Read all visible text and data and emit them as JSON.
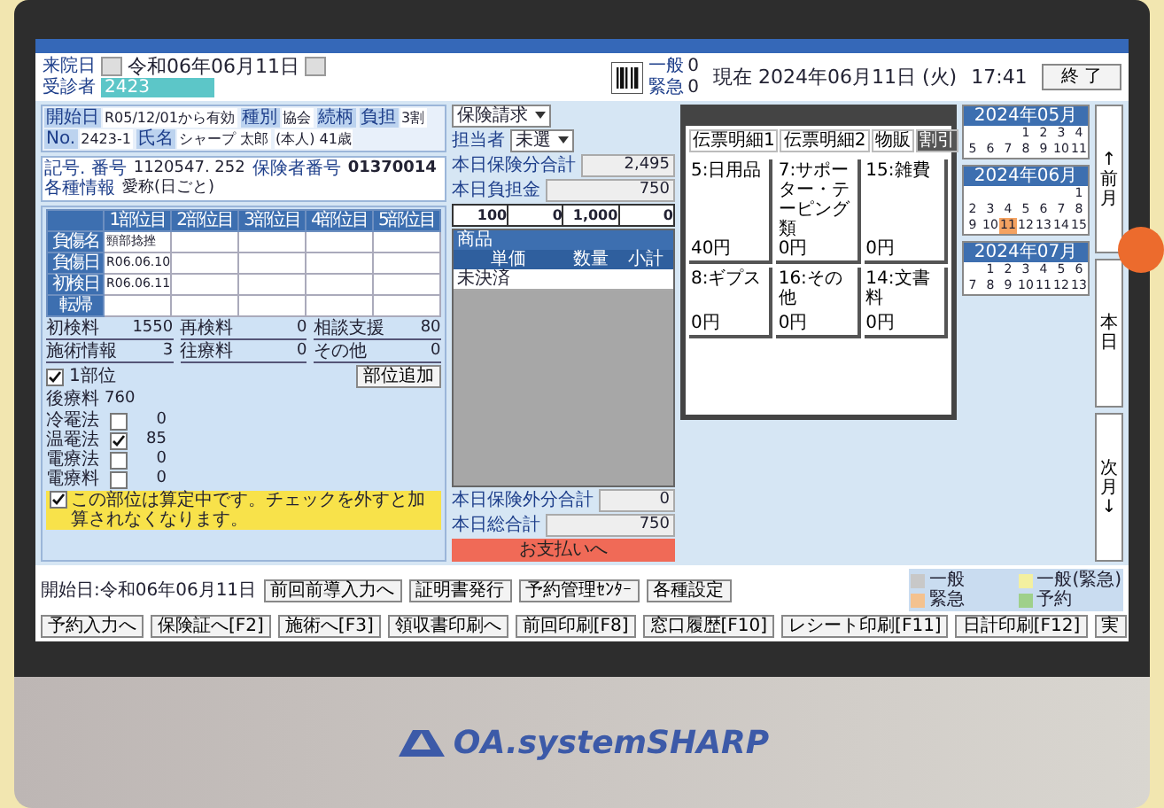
{
  "header": {
    "visit_label": "来院日",
    "visit_date": "令和06年06月11日",
    "patient_label": "受診者",
    "patient_no": "2423",
    "counters": [
      {
        "label": "一般",
        "value": "0"
      },
      {
        "label": "緊急",
        "value": "0"
      }
    ],
    "now": "現在 2024年06月11日 (火)",
    "time": "17:41",
    "end_button": "終 了"
  },
  "patient": {
    "rows": [
      [
        {
          "label": "開始日",
          "value": "R05/12/01から有効"
        },
        {
          "label": "種別",
          "value": "協会"
        },
        {
          "label": "続柄"
        },
        {
          "label": "負担",
          "value": "3割"
        }
      ],
      [
        {
          "label": "No.",
          "value": "2423-1"
        },
        {
          "label": "氏名",
          "value": "シャープ 太郎"
        },
        {
          "value": "(本人) 41歳"
        }
      ]
    ],
    "number_label": "記号. 番号",
    "number": "1120547. 252",
    "insurer_label": "保険者番号",
    "insurer": "01370014",
    "info_label": "各種情報",
    "info": "愛称(日ごと)"
  },
  "injury_table": {
    "columns": [
      "1部位目",
      "2部位目",
      "3部位目",
      "4部位目",
      "5部位目"
    ],
    "rows": [
      {
        "label": "負傷名",
        "cells": [
          "頸部捻挫"
        ]
      },
      {
        "label": "負傷日",
        "cells": [
          "R06.06.10"
        ]
      },
      {
        "label": "初検日",
        "cells": [
          "R06.06.11"
        ]
      },
      {
        "label": "転帰",
        "cells": []
      }
    ]
  },
  "fees": [
    {
      "label": "初検料",
      "value": "1550"
    },
    {
      "label": "再検料",
      "value": "0"
    },
    {
      "label": "相談支援",
      "value": "80"
    },
    {
      "label": "施術情報",
      "value": "3"
    },
    {
      "label": "往療料",
      "value": "0"
    },
    {
      "label": "その他",
      "value": "0"
    }
  ],
  "add_part_button": "部位追加",
  "one_part": {
    "label": "1部位",
    "checked": true
  },
  "aftercare": {
    "label": "後療料",
    "value": "760"
  },
  "options": [
    {
      "label": "冷罨法",
      "checked": false,
      "value": "0"
    },
    {
      "label": "温罨法",
      "checked": true,
      "value": "85"
    },
    {
      "label": "電療法",
      "checked": false,
      "value": "0"
    },
    {
      "label": "電療料",
      "checked": false,
      "value": "0"
    }
  ],
  "notice": {
    "checked": true,
    "text": "この部位は算定中です。チェックを外すと加算されなくなります。"
  },
  "billing": {
    "mode": "保険請求",
    "staff_label": "担当者",
    "staff": "未選",
    "insurance_total_label": "本日保険分合計",
    "insurance_total": "2,495",
    "copay_label": "本日負担金",
    "copay": "750",
    "summary_values": [
      "100",
      "0",
      "1,000",
      "0"
    ]
  },
  "goods": {
    "header": "商品",
    "columns": [
      "単価",
      "数量",
      "小計"
    ],
    "row_label": "未決済",
    "other_total_label": "本日保険外分合計",
    "other_total": "0",
    "grand_total_label": "本日総合計",
    "grand_total": "750",
    "pay_button": "お支払いへ"
  },
  "popup": {
    "tabs": [
      {
        "label": "伝票明細1",
        "selected": false
      },
      {
        "label": "伝票明細2",
        "selected": false
      },
      {
        "label": "物販",
        "selected": false
      },
      {
        "label": "割引",
        "selected": true
      }
    ],
    "items": [
      {
        "name": "5:日用品",
        "price": "40円"
      },
      {
        "name": "7:サポーター・テーピング類",
        "price": "0円"
      },
      {
        "name": "15:雑費",
        "price": "0円"
      },
      {
        "name": "8:ギプス",
        "price": "0円"
      },
      {
        "name": "16:その他",
        "price": "0円"
      },
      {
        "name": "14:文書料",
        "price": "0円"
      }
    ]
  },
  "calendars": [
    {
      "title": "2024年05月",
      "weeks": [
        [
          {
            "kind": "blank"
          },
          {
            "kind": "blank"
          },
          {
            "kind": "blank"
          },
          {
            "kind": "day",
            "day": "1",
            "selected": false
          },
          {
            "kind": "day",
            "day": "2",
            "selected": false
          },
          {
            "kind": "day",
            "day": "3",
            "selected": false
          },
          {
            "kind": "day",
            "day": "4",
            "selected": false
          }
        ],
        [
          {
            "kind": "day",
            "day": "5",
            "selected": false
          },
          {
            "kind": "day",
            "day": "6",
            "selected": false
          },
          {
            "kind": "day",
            "day": "7",
            "selected": false
          },
          {
            "kind": "day",
            "day": "8",
            "selected": false
          },
          {
            "kind": "day",
            "day": "9",
            "selected": false
          },
          {
            "kind": "day",
            "day": "10",
            "selected": false
          },
          {
            "kind": "day",
            "day": "11",
            "selected": false
          }
        ]
      ]
    },
    {
      "title": "2024年06月",
      "weeks": [
        [
          {
            "kind": "blank"
          },
          {
            "kind": "blank"
          },
          {
            "kind": "blank"
          },
          {
            "kind": "blank"
          },
          {
            "kind": "blank"
          },
          {
            "kind": "blank"
          },
          {
            "kind": "day",
            "day": "1",
            "selected": false
          }
        ],
        [
          {
            "kind": "day",
            "day": "2",
            "selected": false
          },
          {
            "kind": "day",
            "day": "3",
            "selected": false
          },
          {
            "kind": "day",
            "day": "4",
            "selected": false
          },
          {
            "kind": "day",
            "day": "5",
            "selected": false
          },
          {
            "kind": "day",
            "day": "6",
            "selected": false
          },
          {
            "kind": "day",
            "day": "7",
            "selected": false
          },
          {
            "kind": "day",
            "day": "8",
            "selected": false
          }
        ],
        [
          {
            "kind": "day",
            "day": "9",
            "selected": false
          },
          {
            "kind": "day",
            "day": "10",
            "selected": false
          },
          {
            "kind": "day",
            "day": "11",
            "selected": true
          },
          {
            "kind": "day",
            "day": "12",
            "selected": false
          },
          {
            "kind": "day",
            "day": "13",
            "selected": false
          },
          {
            "kind": "day",
            "day": "14",
            "selected": false
          },
          {
            "kind": "day",
            "day": "15",
            "selected": false
          }
        ]
      ]
    },
    {
      "title": "2024年07月",
      "weeks": [
        [
          {
            "kind": "blank"
          },
          {
            "kind": "day",
            "day": "1",
            "selected": false
          },
          {
            "kind": "day",
            "day": "2",
            "selected": false
          },
          {
            "kind": "day",
            "day": "3",
            "selected": false
          },
          {
            "kind": "day",
            "day": "4",
            "selected": false
          },
          {
            "kind": "day",
            "day": "5",
            "selected": false
          },
          {
            "kind": "day",
            "day": "6",
            "selected": false
          }
        ],
        [
          {
            "kind": "day",
            "day": "7",
            "selected": false
          },
          {
            "kind": "day",
            "day": "8",
            "selected": false
          },
          {
            "kind": "day",
            "day": "9",
            "selected": false
          },
          {
            "kind": "day",
            "day": "10",
            "selected": false
          },
          {
            "kind": "day",
            "day": "11",
            "selected": false
          },
          {
            "kind": "day",
            "day": "12",
            "selected": false
          },
          {
            "kind": "day",
            "day": "13",
            "selected": false
          }
        ]
      ]
    }
  ],
  "side_buttons": [
    "↑前月",
    "本日",
    "次月↓"
  ],
  "footer": {
    "start": "開始日:令和06年06月11日",
    "top_buttons": [
      "前回前導入力へ",
      "証明書発行",
      "予約管理ｾﾝﾀｰ",
      "各種設定"
    ],
    "legend": [
      {
        "label": "一般",
        "color": "#c8c8c8"
      },
      {
        "label": "一般(緊急)",
        "color": "#f3f0a0"
      },
      {
        "label": "緊急",
        "color": "#f4c28f"
      },
      {
        "label": "予約",
        "color": "#9fd08a"
      }
    ],
    "buttons": [
      "予約入力へ",
      "保険証へ[F2]",
      "施術へ[F3]",
      "領収書印刷へ",
      "前回印刷[F8]",
      "窓口履歴[F10]",
      "レシート印刷[F11]",
      "日計印刷[F12]"
    ],
    "small_button": "実"
  },
  "brand": "OA.systemSHARP"
}
